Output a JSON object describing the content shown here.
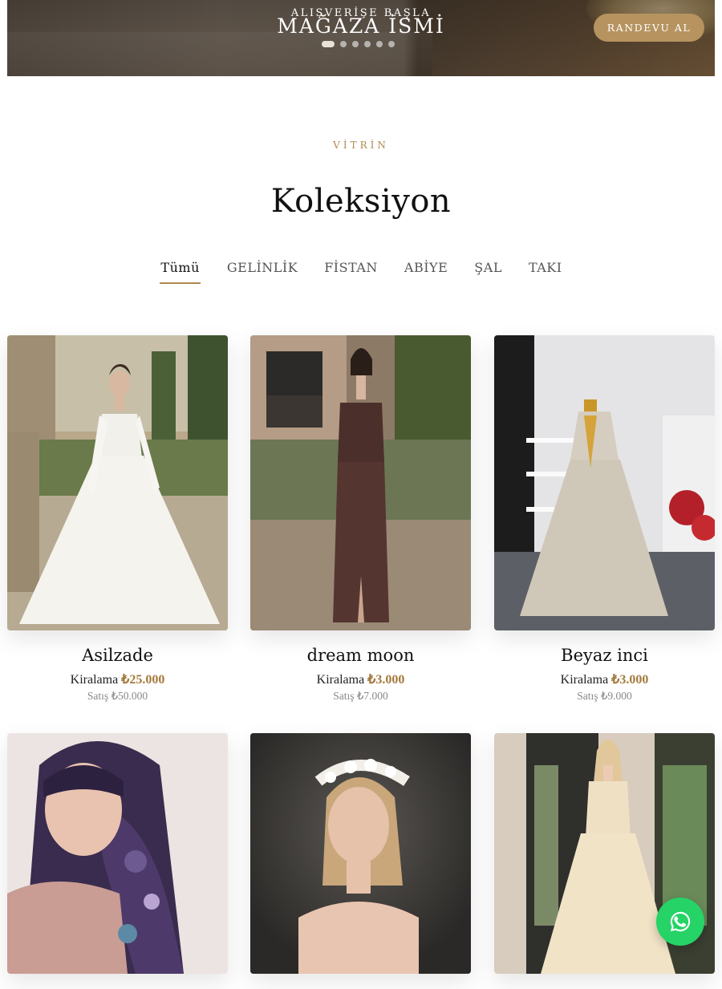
{
  "hero": {
    "eyebrow": "ALIŞVERİŞE BAŞLA",
    "title": "MAĞAZA İSMİ",
    "slides_total": 6,
    "active_slide": 1,
    "appointment_button": "RANDEVU AL"
  },
  "section": {
    "eyebrow": "VİTRİN",
    "title": "Koleksiyon"
  },
  "tabs": [
    "Tümü",
    "GELİNLİK",
    "FİSTAN",
    "ABİYE",
    "ŞAL",
    "TAKI"
  ],
  "active_tab": "Tümü",
  "products": [
    {
      "name": "Asilzade",
      "rent_label": "Kiralama",
      "rent_price": "₺25.000",
      "sale_text": "Satış ₺50.000"
    },
    {
      "name": "dream moon",
      "rent_label": "Kiralama",
      "rent_price": "₺3.000",
      "sale_text": "Satış ₺7.000"
    },
    {
      "name": "Beyaz inci",
      "rent_label": "Kiralama",
      "rent_price": "₺3.000",
      "sale_text": "Satış ₺9.000"
    },
    {
      "name": "",
      "rent_label": "",
      "rent_price": "",
      "sale_text": ""
    },
    {
      "name": "",
      "rent_label": "",
      "rent_price": "",
      "sale_text": ""
    },
    {
      "name": "",
      "rent_label": "",
      "rent_price": "",
      "sale_text": ""
    }
  ],
  "floating_button": {
    "icon": "whatsapp-icon",
    "color": "#25d366"
  },
  "colors": {
    "accent": "#b08a52",
    "price": "#a47a3c",
    "button": "#b6935f"
  }
}
